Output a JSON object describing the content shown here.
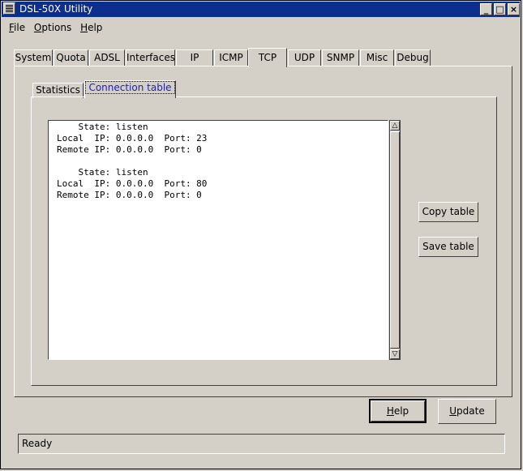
{
  "window": {
    "title": "DSL-50X Utility",
    "controls": [
      "_",
      "□",
      "×"
    ]
  },
  "menu": [
    {
      "accel": "F",
      "rest": "ile"
    },
    {
      "accel": "O",
      "rest": "ptions"
    },
    {
      "accel": "H",
      "rest": "elp"
    }
  ],
  "tabs": [
    "System",
    "Quota",
    "ADSL",
    "Interfaces",
    "IP",
    "ICMP",
    "TCP",
    "UDP",
    "SNMP",
    "Misc",
    "Debug"
  ],
  "active_tab": "TCP",
  "subtabs": [
    "Statistics",
    "Connection table"
  ],
  "active_subtab": "Connection table",
  "connection_table": [
    "    State: listen",
    "Local  IP: 0.0.0.0  Port: 23",
    "Remote IP: 0.0.0.0  Port: 0",
    "",
    "    State: listen",
    "Local  IP: 0.0.0.0  Port: 80",
    "Remote IP: 0.0.0.0  Port: 0"
  ],
  "buttons": {
    "copy_table": "Copy table",
    "save_table": "Save table",
    "help_accel": "H",
    "help_rest": "elp",
    "update_accel": "U",
    "update_rest": "pdate"
  },
  "status": "Ready",
  "icons": {
    "scroll_up": "△",
    "scroll_down": "▽"
  }
}
